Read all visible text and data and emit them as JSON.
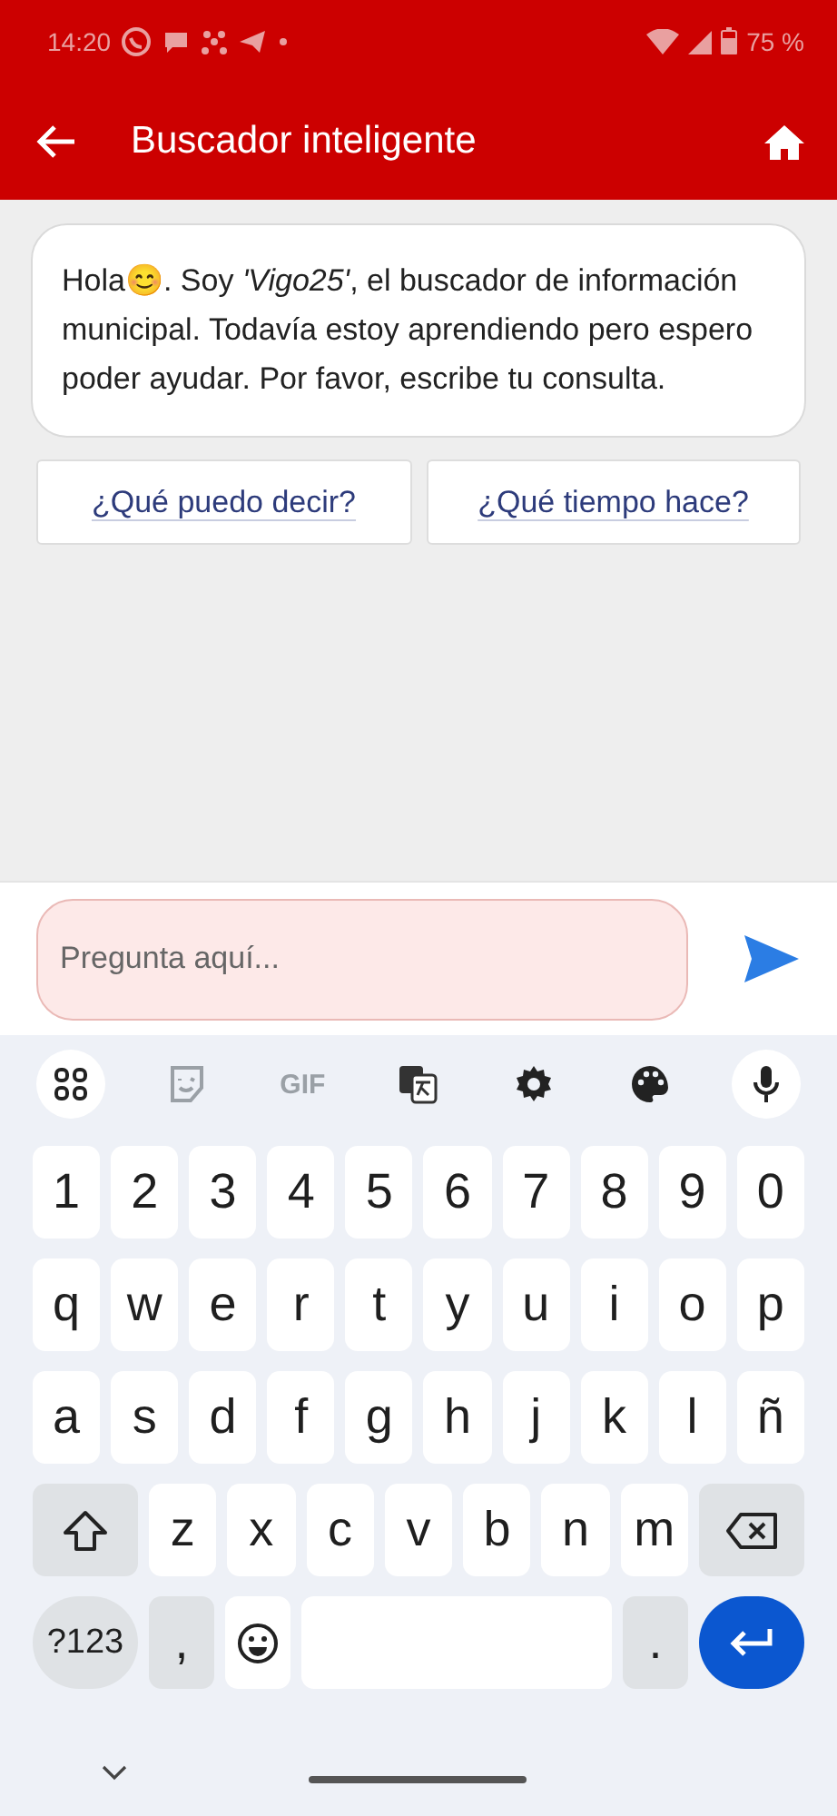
{
  "status_bar": {
    "time": "14:20",
    "battery": "75 %"
  },
  "app_bar": {
    "title": "Buscador inteligente"
  },
  "messages": [
    {
      "text": "Hola😊. Soy *'Vigo25'*, el buscador de información municipal. Todavía estoy aprendiendo pero espero poder ayudar. Por favor, escribe tu consulta."
    }
  ],
  "suggestions": [
    "¿Qué puedo decir?",
    "¿Qué tiempo hace?"
  ],
  "input": {
    "placeholder": "Pregunta aquí..."
  },
  "keyboard": {
    "toolbar": [
      {
        "kind": "apps"
      },
      {
        "kind": "sticker"
      },
      {
        "kind": "gif",
        "label": "GIF"
      },
      {
        "kind": "translate"
      },
      {
        "kind": "settings"
      },
      {
        "kind": "palette"
      },
      {
        "kind": "mic"
      }
    ],
    "rows": [
      [
        {
          "kind": "char",
          "label": "1"
        },
        {
          "kind": "char",
          "label": "2"
        },
        {
          "kind": "char",
          "label": "3"
        },
        {
          "kind": "char",
          "label": "4"
        },
        {
          "kind": "char",
          "label": "5"
        },
        {
          "kind": "char",
          "label": "6"
        },
        {
          "kind": "char",
          "label": "7"
        },
        {
          "kind": "char",
          "label": "8"
        },
        {
          "kind": "char",
          "label": "9"
        },
        {
          "kind": "char",
          "label": "0"
        }
      ],
      [
        {
          "kind": "char",
          "label": "q"
        },
        {
          "kind": "char",
          "label": "w"
        },
        {
          "kind": "char",
          "label": "e"
        },
        {
          "kind": "char",
          "label": "r"
        },
        {
          "kind": "char",
          "label": "t"
        },
        {
          "kind": "char",
          "label": "y"
        },
        {
          "kind": "char",
          "label": "u"
        },
        {
          "kind": "char",
          "label": "i"
        },
        {
          "kind": "char",
          "label": "o"
        },
        {
          "kind": "char",
          "label": "p"
        }
      ],
      [
        {
          "kind": "char",
          "label": "a"
        },
        {
          "kind": "char",
          "label": "s"
        },
        {
          "kind": "char",
          "label": "d"
        },
        {
          "kind": "char",
          "label": "f"
        },
        {
          "kind": "char",
          "label": "g"
        },
        {
          "kind": "char",
          "label": "h"
        },
        {
          "kind": "char",
          "label": "j"
        },
        {
          "kind": "char",
          "label": "k"
        },
        {
          "kind": "char",
          "label": "l"
        },
        {
          "kind": "char",
          "label": "ñ"
        }
      ],
      [
        {
          "kind": "shift"
        },
        {
          "kind": "char",
          "label": "z"
        },
        {
          "kind": "char",
          "label": "x"
        },
        {
          "kind": "char",
          "label": "c"
        },
        {
          "kind": "char",
          "label": "v"
        },
        {
          "kind": "char",
          "label": "b"
        },
        {
          "kind": "char",
          "label": "n"
        },
        {
          "kind": "char",
          "label": "m"
        },
        {
          "kind": "backspace"
        }
      ],
      [
        {
          "kind": "symbols",
          "label": "?123"
        },
        {
          "kind": "punct",
          "label": ","
        },
        {
          "kind": "emoji"
        },
        {
          "kind": "space"
        },
        {
          "kind": "punct",
          "label": "."
        },
        {
          "kind": "enter"
        }
      ]
    ]
  }
}
